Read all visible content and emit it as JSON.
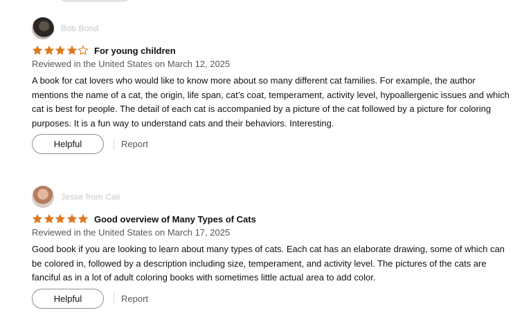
{
  "colors": {
    "star_fill": "#de7921",
    "star_empty": "#de7921",
    "meta_text": "#565959",
    "button_border": "#8d9096"
  },
  "reviews": [
    {
      "author": "Bob Bond",
      "rating": 4,
      "title": "For young children",
      "meta": "Reviewed in the United States on March 12, 2025",
      "body": "A book for cat lovers who would like to know more about so many different cat families. For example, the author mentions the name of a cat, the origin, life span, cat’s coat, temperament, activity level, hypoallergenic issues and which cat is best for people. The detail of each cat is accompanied by a picture of the cat followed by a picture for coloring purposes. It is a fun way to understand cats and their behaviors. Interesting.",
      "helpful_label": "Helpful",
      "report_label": "Report"
    },
    {
      "author": "Jesse from Cali",
      "rating": 5,
      "title": "Good overview of Many Types of Cats",
      "meta": "Reviewed in the United States on March 17, 2025",
      "body": "Good book if you are looking to learn about many types of cats. Each cat has an elaborate drawing, some of which can be colored in, followed by a description including size, temperament, and activity level. The pictures of the cats are fanciful as in a lot of adult coloring books with sometimes little actual area to add color.",
      "helpful_label": "Helpful",
      "report_label": "Report"
    }
  ],
  "icons": {
    "avatar": "user-avatar-icon",
    "star": "star-icon"
  }
}
